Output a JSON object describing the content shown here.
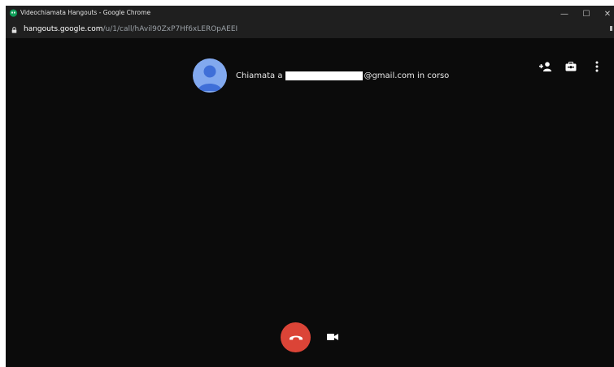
{
  "window": {
    "title": "Videochiamata Hangouts - Google Chrome",
    "controls": {
      "minimize": "—",
      "maximize": "☐",
      "close": "✕"
    }
  },
  "address_bar": {
    "host": "hangouts.google.com",
    "path": "/u/1/call/hAvil90ZxP7Hf6xLEROpAEEI"
  },
  "call": {
    "prefix": "Chiamata a",
    "suffix": "@gmail.com in corso",
    "redacted": true
  },
  "toolbar": {
    "icons": [
      "add-person-icon",
      "settings-icon",
      "more-options-icon"
    ]
  },
  "controls": {
    "hangup_icon": "phone-hangup-icon",
    "video_icon": "video-camera-icon"
  },
  "colors": {
    "background": "#0b0b0b",
    "titlebar": "#1f1f1f",
    "avatar": "#82a9ef",
    "hangup": "#db4437"
  }
}
